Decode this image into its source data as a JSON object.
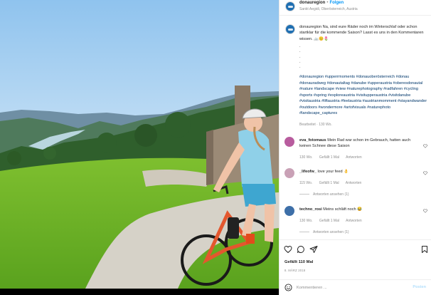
{
  "post": {
    "username": "donauregion",
    "separator": "•",
    "follow_label": "Folgen",
    "location": "Sankt Aegidi, Oberösterreich, Austria",
    "caption_username": "donauregion",
    "caption_text": "Na, sind eure Räder noch im Winterschlaf oder schon startklar für die kommende Saison? Lasst es uns in den Kommentaren wissen. 🚲😊🌷",
    "caption_dots": [
      ".",
      ".",
      ".",
      ".",
      "."
    ],
    "hashtags": "#donauregion #upperrmoments #donauoberösterreich #donau #donauradweg #donautaltag #danube #upperaustria #oberesdonautal #nature #landscape #view #naturephotography #radfahren #cycling #sports #spring #exploreaustria #visitupperaustria #visitdanube #visitaustria #liftaustria #feelaustria #austrianmomment #stayandwander #outdoors #wondermore #artofvisuals #naturephoto #landscape_captures",
    "caption_meta": "Bearbeitet · 130 Wo."
  },
  "comments": [
    {
      "username": "eva_fotomaus",
      "text": "Mein Rad war schon im Gebrauch, hatten auch keinen Schnee diese Saison",
      "age": "130 Wo.",
      "likes": "Gefällt 1 Mal",
      "reply": "Antworten",
      "avatar_color": "#b85c9e"
    },
    {
      "username": "_lifeofw_",
      "text": "love your feed 👌",
      "age": "115 Wo.",
      "likes": "Gefällt 1 Mal",
      "reply": "Antworten",
      "avatar_color": "#c9a1b6",
      "view_replies": "Antworten ansehen (1)"
    },
    {
      "username": "techno_rosi",
      "text": "Meins schläft noch 😂",
      "age": "130 Wo.",
      "likes": "Gefällt 1 Mal",
      "reply": "Antworten",
      "avatar_color": "#3d6fa8",
      "view_replies": "Antworten ansehen (1)"
    }
  ],
  "actions": {
    "like_icon": "heart-icon",
    "comment_icon": "comment-icon",
    "share_icon": "share-icon",
    "save_icon": "bookmark-icon"
  },
  "likes_text": "Gefällt 110 Mal",
  "date_text": "8. MÄRZ 2018",
  "add_comment": {
    "placeholder": "Kommentieren ...",
    "post_label": "Posten",
    "emoji_icon": "smiley-icon"
  },
  "colors": {
    "brand_blue": "#0095f6",
    "link_blue": "#00376b",
    "text": "#262626",
    "muted": "#8e8e8e"
  }
}
